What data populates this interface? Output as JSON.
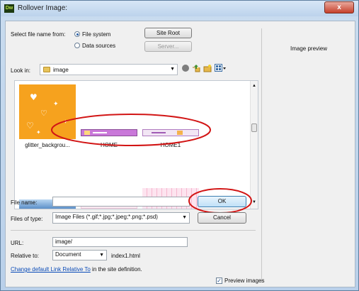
{
  "window": {
    "app_icon_text": "Dw",
    "title": "Rollover Image:",
    "close_glyph": "x"
  },
  "select_from": {
    "label": "Select file name from:",
    "options": [
      "File system",
      "Data sources"
    ],
    "selected": "File system"
  },
  "buttons": {
    "site_root": "Site Root",
    "server": "Server...",
    "ok": "OK",
    "cancel": "Cancel"
  },
  "preview_panel": {
    "label": "Image preview"
  },
  "look_in": {
    "label": "Look in:",
    "value": "image",
    "toolbar_icons": [
      "back-icon",
      "up-folder-icon",
      "new-folder-icon",
      "view-menu-icon"
    ]
  },
  "files": [
    {
      "name": "glitter_backgrou..."
    },
    {
      "name": "HOME"
    },
    {
      "name": "HOME1"
    }
  ],
  "file_name": {
    "label": "File name:",
    "value": ""
  },
  "files_of_type": {
    "label": "Files of type:",
    "value": "Image Files (*.gif;*.jpg;*.jpeg;*.png;*.psd)"
  },
  "url": {
    "label": "URL:",
    "value": "image/"
  },
  "relative_to": {
    "label": "Relative to:",
    "value": "Document",
    "file": "index1.html"
  },
  "link_note": {
    "link_text": "Change default Link Relative To",
    "rest_text": " in the site definition."
  },
  "preview_images": {
    "label": "Preview images",
    "checked": true
  },
  "colors": {
    "annotation_red": "#d21515",
    "glitter_orange": "#f6a21e"
  }
}
